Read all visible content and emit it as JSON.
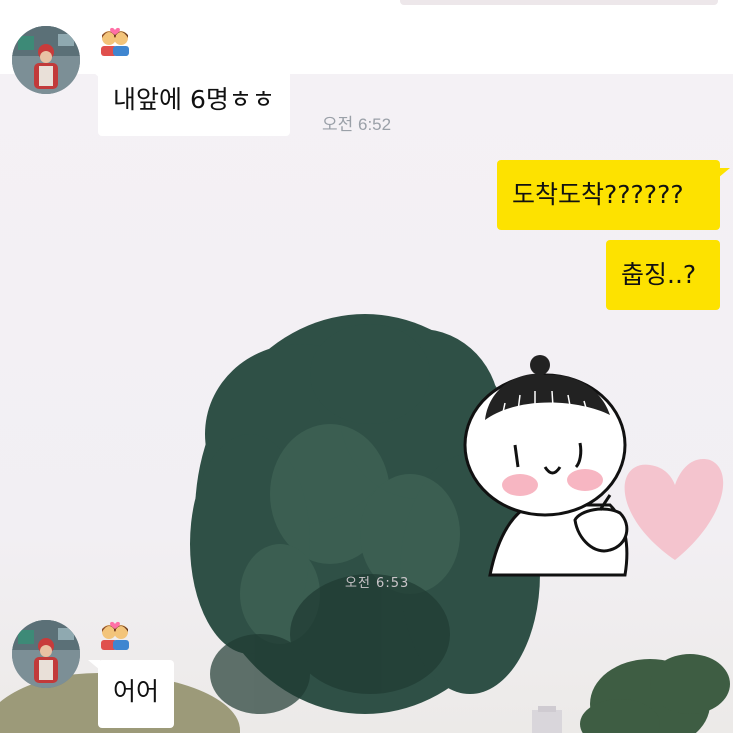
{
  "chat": {
    "messages": [
      {
        "text": "내앞에 6명ㅎㅎ",
        "time": "오전 6:52"
      },
      {
        "text": "도착도착??????"
      },
      {
        "text": "춥징..?"
      },
      {
        "text": "어어"
      }
    ],
    "faint_time": "오전 6:53"
  },
  "icons": {
    "sender_badge": "couple-emoji-icon",
    "sticker": "bun-hair-character-finger-heart-sticker"
  },
  "colors": {
    "outgoing_bubble": "#fde200",
    "incoming_bubble": "#ffffff",
    "time_text": "#9aa0a8"
  }
}
